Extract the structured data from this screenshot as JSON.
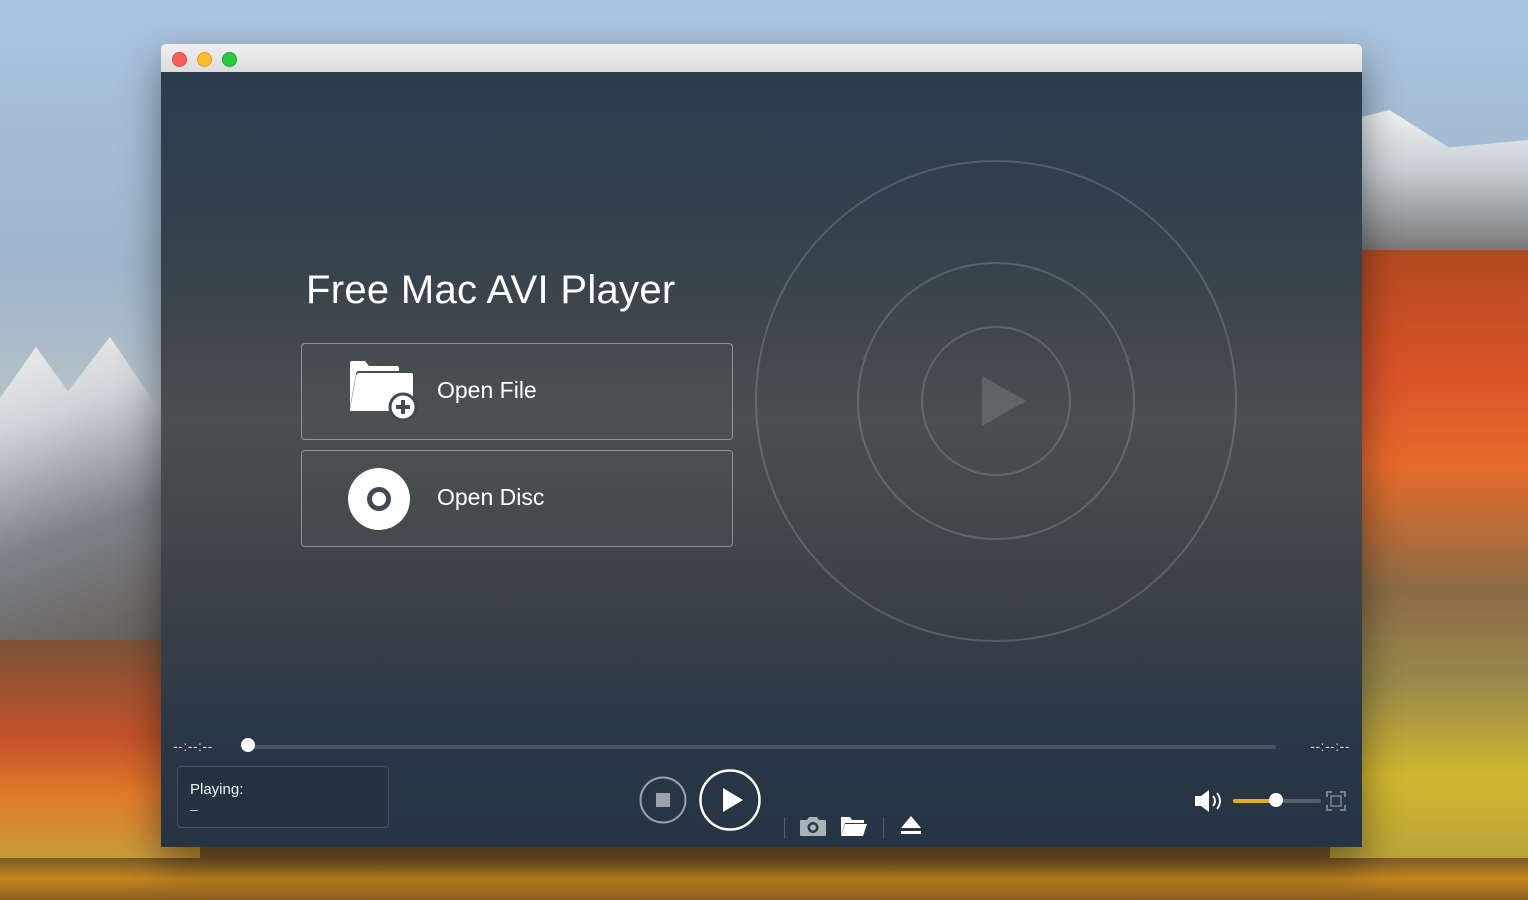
{
  "window": {
    "title": "",
    "traffic_lights": {
      "close": "#fc5f57",
      "minimize": "#fdbc2e",
      "maximize": "#29c93f"
    }
  },
  "main": {
    "app_title": "Free Mac AVI Player",
    "open_file_label": "Open File",
    "open_disc_label": "Open Disc",
    "open_file_icon": "folder-add-icon",
    "open_disc_icon": "disc-icon"
  },
  "playback": {
    "time_elapsed": "--:--:--",
    "time_total": "--:--:--",
    "progress": 0,
    "playing_label": "Playing:",
    "playing_value": "–"
  },
  "controls": {
    "stop_icon": "stop-icon",
    "play_icon": "play-icon",
    "snapshot_icon": "camera-icon",
    "folder_icon": "folder-icon",
    "eject_icon": "eject-icon",
    "volume_icon": "speaker-icon",
    "fullscreen_icon": "fullscreen-icon",
    "volume_level": 0.5
  },
  "colors": {
    "accent": "#e9a827",
    "panel_bg": "#2c3a49",
    "text": "#ffffff"
  }
}
